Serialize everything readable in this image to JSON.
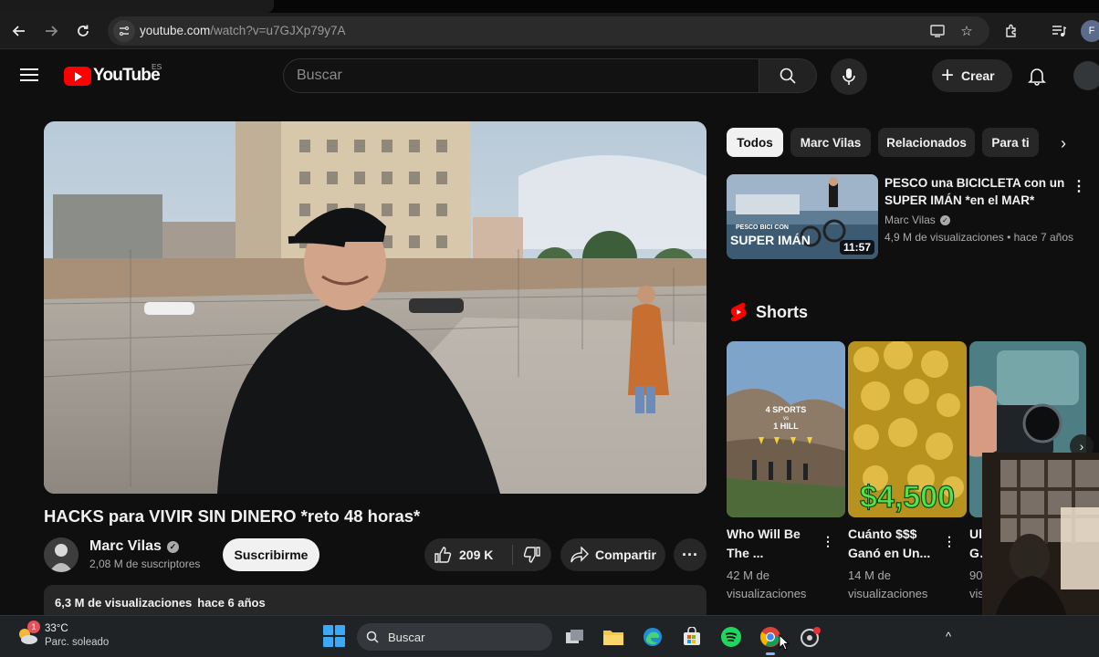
{
  "browser": {
    "url_host": "youtube.com",
    "url_path": "/watch?v=u7GJXp79y7A",
    "icons": [
      "back-arrow-icon",
      "forward-arrow-icon",
      "reload-icon",
      "site-info-icon",
      "cast-icon",
      "bookmark-star-icon",
      "extensions-icon",
      "media-icon"
    ],
    "profile_initial": "F"
  },
  "header": {
    "logo_text": "YouTube",
    "country_code": "ES",
    "search_placeholder": "Buscar",
    "create_label": "Crear"
  },
  "video": {
    "title": "HACKS para VIVIR SIN DINERO *reto 48 horas*",
    "channel": "Marc Vilas",
    "subscribers": "2,08 M de suscriptores",
    "subscribe_label": "Suscribirme",
    "likes": "209 K",
    "share_label": "Compartir",
    "views": "6,3 M de visualizaciones",
    "age": "hace 6 años"
  },
  "chips": [
    "Todos",
    "Marc Vilas",
    "Relacionados",
    "Para ti"
  ],
  "related": [
    {
      "title_line1": "PESCO una BICICLETA con un",
      "title_line2": "SUPER IMÁN *en el MAR*",
      "channel": "Marc Vilas",
      "meta": "4,9 M de visualizaciones • hace 7 años",
      "duration": "11:57",
      "thumb_text_small": "PESCO BICI CON",
      "thumb_text_big": "SUPER IMÁN"
    }
  ],
  "shorts": {
    "heading": "Shorts",
    "items": [
      {
        "title_line1": "Who Will Be",
        "title_line2": "The ...",
        "views_line1": "42 M de",
        "views_line2": "visualizaciones",
        "thumb_text1": "4 SPORTS",
        "thumb_text2": "vs",
        "thumb_text3": "1 HILL"
      },
      {
        "title_line1": "Cuánto $$$",
        "title_line2": "Ganó en Un...",
        "views_line1": "14 M de",
        "views_line2": "visualizaciones",
        "thumb_text1": "$4,500"
      },
      {
        "title_line1": "Ul",
        "title_line2": "Go",
        "views_line1": "90",
        "views_line2": "vis"
      }
    ]
  },
  "taskbar": {
    "temperature": "33°C",
    "weather": "Parc. soleado",
    "weather_badge": "1",
    "search_label": "Buscar"
  },
  "colors": {
    "background": "#0f0f0f",
    "youtube_red": "#ff0000",
    "chip_active": "#f1f1f1",
    "taskbar": "#202326"
  }
}
